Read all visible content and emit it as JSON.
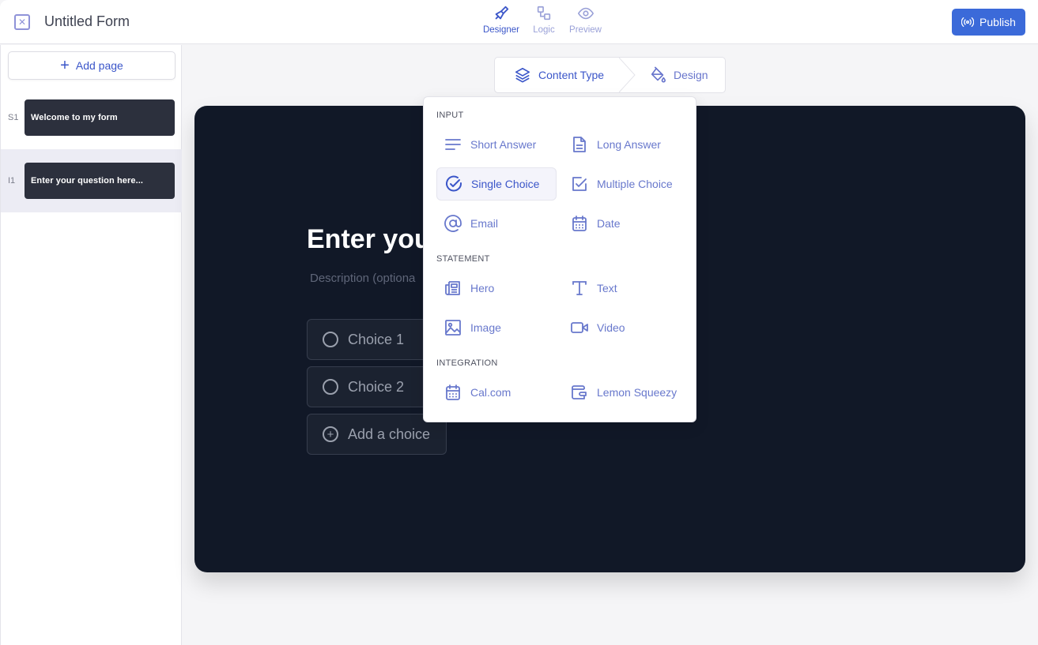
{
  "header": {
    "title": "Untitled Form",
    "close_icon": "close-icon",
    "modes": [
      {
        "label": "Designer",
        "icon": "brush-icon",
        "active": true
      },
      {
        "label": "Logic",
        "icon": "logic-nodes-icon",
        "active": false
      },
      {
        "label": "Preview",
        "icon": "eye-icon",
        "active": false
      }
    ],
    "publish_label": "Publish",
    "publish_icon": "broadcast-icon",
    "accent": "#3b6ad9"
  },
  "sidebar": {
    "add_page_label": "Add page",
    "pages": [
      {
        "index": "S1",
        "title": "Welcome to my form",
        "selected": false
      },
      {
        "index": "I1",
        "title": "Enter your question here...",
        "selected": true
      }
    ]
  },
  "breadcrumb": {
    "steps": [
      {
        "label": "Content Type",
        "icon": "layers-icon"
      },
      {
        "label": "Design",
        "icon": "paint-bucket-icon"
      }
    ]
  },
  "canvas": {
    "question": "Enter your question here...",
    "question_visible": "Enter you",
    "description": "Description (optional)",
    "description_visible": "Description (optiona",
    "choices": [
      "Choice 1",
      "Choice 2"
    ],
    "add_choice_label": "Add a choice",
    "background": "#111827"
  },
  "content_type_menu": {
    "sections": [
      {
        "label": "INPUT",
        "items": [
          {
            "label": "Short Answer",
            "icon": "short-text-icon"
          },
          {
            "label": "Long Answer",
            "icon": "document-icon"
          },
          {
            "label": "Single Choice",
            "icon": "circle-check-icon",
            "highlighted": true
          },
          {
            "label": "Multiple Choice",
            "icon": "square-check-icon"
          },
          {
            "label": "Email",
            "icon": "at-sign-icon"
          },
          {
            "label": "Date",
            "icon": "calendar-icon"
          }
        ]
      },
      {
        "label": "STATEMENT",
        "items": [
          {
            "label": "Hero",
            "icon": "newspaper-icon"
          },
          {
            "label": "Text",
            "icon": "text-type-icon"
          },
          {
            "label": "Image",
            "icon": "image-icon"
          },
          {
            "label": "Video",
            "icon": "video-icon"
          }
        ]
      },
      {
        "label": "INTEGRATION",
        "items": [
          {
            "label": "Cal.com",
            "icon": "calendar-icon"
          },
          {
            "label": "Lemon Squeezy",
            "icon": "wallet-icon"
          }
        ]
      }
    ]
  }
}
